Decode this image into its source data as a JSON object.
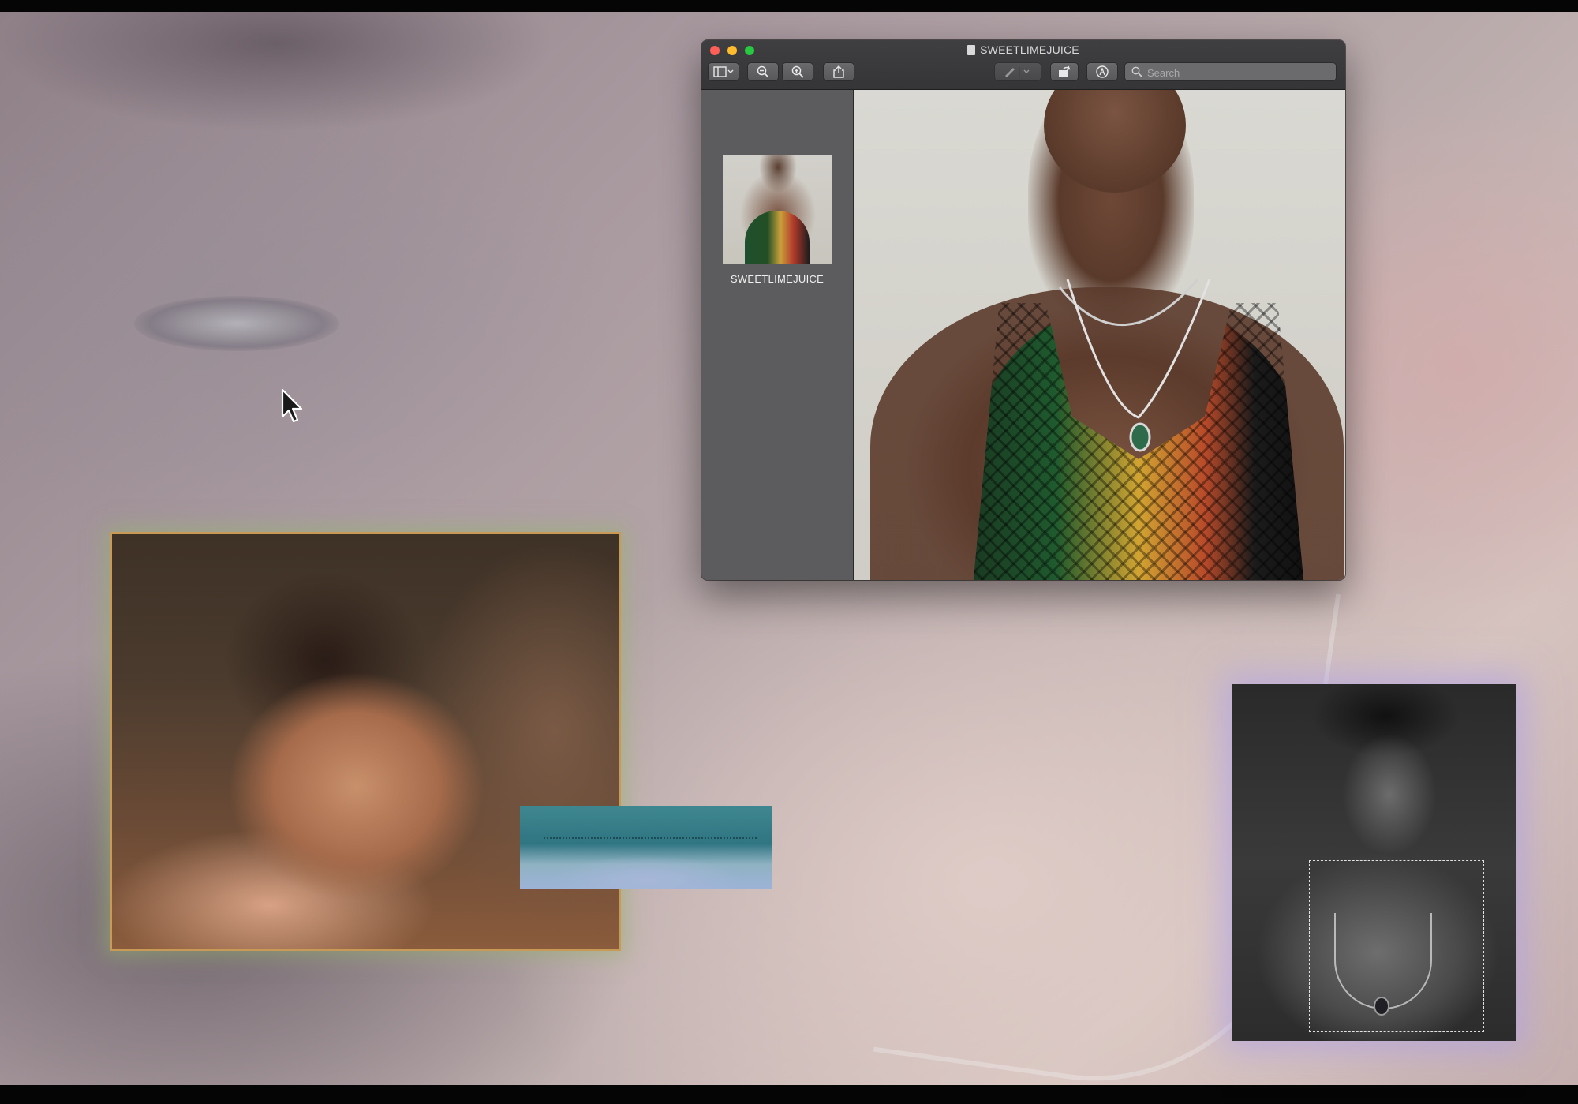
{
  "preview": {
    "title": "SWEETLIMEJUICE",
    "search_placeholder": "Search",
    "thumbnails": [
      {
        "label": "SWEETLIMEJUICE"
      }
    ]
  },
  "icons": {
    "traffic_lights": [
      "close-icon",
      "minimize-icon",
      "zoom-icon"
    ],
    "toolbar": [
      "sidebar-toggle-icon",
      "zoom-out-icon",
      "zoom-in-icon",
      "share-icon",
      "markup-pen-icon",
      "rotate-icon",
      "annotate-icon",
      "search-icon"
    ],
    "cursor": "arrow-cursor-icon"
  },
  "colors": {
    "traffic_close": "#ff5f57",
    "traffic_minimize": "#febc2e",
    "traffic_zoom": "#28c840",
    "bed_photo_border": "#c89a55",
    "bw_photo_glow": "#afa0e6"
  }
}
